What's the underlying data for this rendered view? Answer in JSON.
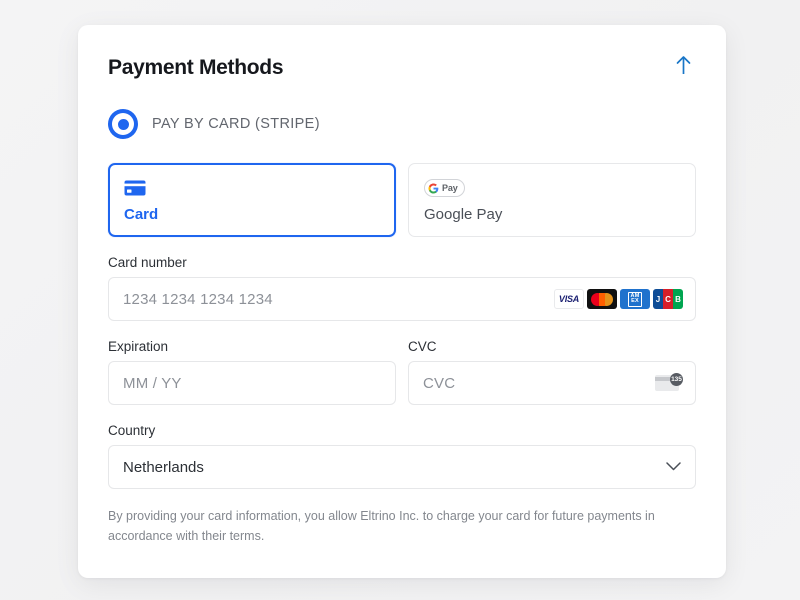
{
  "panel": {
    "title": "Payment Methods",
    "collapse_icon": "arrow-up-icon",
    "accent_color": "#1f66ef"
  },
  "method": {
    "label": "PAY BY CARD (STRIPE)",
    "selected": true,
    "radio_icon": "radio-selected-icon"
  },
  "tabs": [
    {
      "label": "Card",
      "icon": "credit-card-icon",
      "selected": true
    },
    {
      "label": "Google Pay",
      "icon": "google-pay-logo",
      "logo_text": "Pay",
      "selected": false
    }
  ],
  "fields": {
    "card_number": {
      "label": "Card number",
      "placeholder": "1234 1234 1234 1234",
      "value": ""
    },
    "expiration": {
      "label": "Expiration",
      "placeholder": "MM / YY",
      "value": ""
    },
    "cvc": {
      "label": "CVC",
      "placeholder": "CVC",
      "value": "",
      "hint_icon": "cvc-card-icon",
      "hint_badge": "135"
    },
    "country": {
      "label": "Country",
      "value": "Netherlands",
      "chevron_icon": "chevron-down-icon"
    }
  },
  "card_brands": [
    {
      "name": "visa",
      "text": "VISA"
    },
    {
      "name": "mastercard",
      "text": ""
    },
    {
      "name": "amex",
      "text_top": "AM",
      "text_bottom": "EX"
    },
    {
      "name": "jcb",
      "letters": [
        "J",
        "C",
        "B"
      ]
    }
  ],
  "disclaimer": "By providing your card information, you allow Eltrino Inc. to charge your card for future payments in accordance with their terms."
}
